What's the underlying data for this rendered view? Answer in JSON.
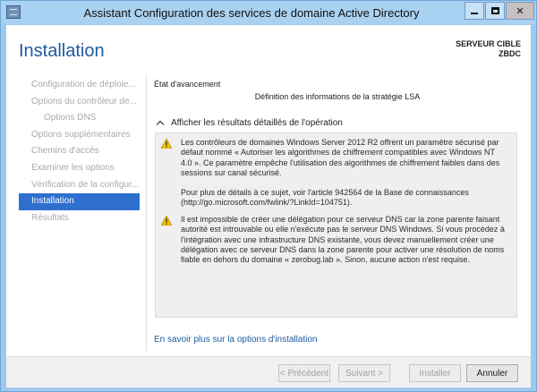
{
  "window": {
    "title": "Assistant Configuration des services de domaine Active Directory"
  },
  "header": {
    "page_title": "Installation",
    "target_label": "SERVEUR CIBLE",
    "target_name": "ZBDC"
  },
  "sidebar": {
    "items": [
      {
        "label": "Configuration de déploie..."
      },
      {
        "label": "Options du contrôleur de..."
      },
      {
        "label": "Options DNS"
      },
      {
        "label": "Options supplémentaires"
      },
      {
        "label": "Chemins d'accès"
      },
      {
        "label": "Examiner les options"
      },
      {
        "label": "Vérification de la configur..."
      },
      {
        "label": "Installation"
      },
      {
        "label": "Résultats"
      }
    ],
    "active_index": 7
  },
  "main": {
    "progress_label": "État d'avancement",
    "status_line": "Définition des informations de la stratégie LSA",
    "details_toggle": "Afficher les résultats détaillés de l'opération",
    "messages": [
      {
        "icon": "warning-icon",
        "paragraphs": [
          "Les contrôleurs de domaines Windows Server 2012 R2 offrent un paramètre sécurisé par défaut nommé « Autoriser les algorithmes de chiffrement compatibles avec Windows NT 4.0 ». Ce paramètre empêche l'utilisation des algorithmes de chiffrement faibles dans des sessions sur canal sécurisé.",
          "Pour plus de détails à ce sujet, voir l'article 942564 de la Base de connaissances (http://go.microsoft.com/fwlink/?LinkId=104751)."
        ]
      },
      {
        "icon": "warning-icon",
        "paragraphs": [
          "Il est impossible de créer une délégation pour ce serveur DNS car la zone parente faisant autorité est introuvable ou elle n'exécute pas le serveur DNS Windows. Si vous procédez à l'intégration avec une infrastructure DNS existante, vous devez manuellement créer une délégation avec ce serveur DNS dans la zone parente pour activer une résolution de noms fiable en dehors du domaine « zerobug.lab ». Sinon, aucune action n'est requise."
        ]
      }
    ],
    "learn_more_link": "En savoir plus sur la options d'installation"
  },
  "footer": {
    "prev_label": "< Précédent",
    "next_label": "Suivant >",
    "install_label": "Installer",
    "cancel_label": "Annuler"
  },
  "colors": {
    "accent": "#2f6fcf",
    "title_blue": "#1e5aa0",
    "titlebar": "#a9d1f1",
    "warning": "#f2c200"
  }
}
